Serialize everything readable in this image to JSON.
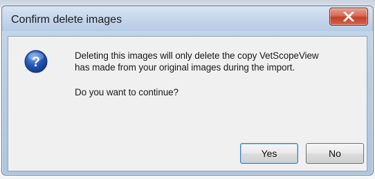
{
  "dialog": {
    "title": "Confirm delete images",
    "close_icon": "close-x-icon",
    "message_icon": "question-icon",
    "message": {
      "line1": "Deleting this images will only delete the copy VetScopeView",
      "line2": "has made from your original images during the import.",
      "line3": "Do you want to continue?"
    },
    "buttons": {
      "yes": "Yes",
      "no": "No"
    }
  }
}
